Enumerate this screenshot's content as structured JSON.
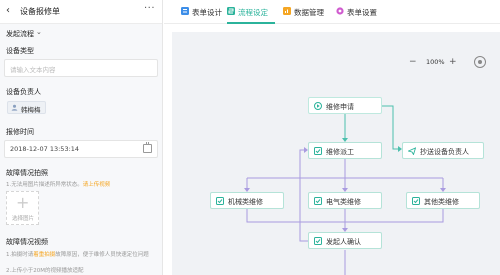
{
  "panel": {
    "back_glyph": "‹",
    "title": "设备报修单",
    "more_glyph": "···",
    "flow_label": "发起流程",
    "flow_chevron": "⌄",
    "fields": {
      "device_type_label": "设备类型",
      "device_type_placeholder": "请输入文本内容",
      "owner_label": "设备负责人",
      "owner_name": "韩梅梅",
      "time_label": "报修时间",
      "time_value": "2018-12-07 13:53:14",
      "photo_label": "故障情况拍照",
      "photo_hint_prefix": "1.无法用图片描述所异常状态。",
      "photo_hint_link": "请上传视频",
      "upload_label": "选择图片",
      "video_label": "故障情况视频",
      "video_hint_1_prefix": "1.拍摄时请",
      "video_hint_1_link": "着重拍摄",
      "video_hint_1_suffix": "故障原因，便于维修人员快速定位问题",
      "video_hint_2": "2.上传小于20M的视频播放适配"
    }
  },
  "tabs": [
    {
      "label": "表单设计",
      "icon": "form-design-icon",
      "color": "#3d8ee8",
      "active": false
    },
    {
      "label": "流程设定",
      "icon": "flow-setting-icon",
      "color": "#2bb39b",
      "active": true
    },
    {
      "label": "数据管理",
      "icon": "data-manage-icon",
      "color": "#f5a623",
      "active": false
    },
    {
      "label": "表单设置",
      "icon": "form-settings-icon",
      "color": "#d05ccf",
      "active": false
    }
  ],
  "zoom": {
    "minus": "−",
    "value": "100%",
    "plus": "+"
  },
  "flow": {
    "nodes": {
      "apply": "维修申请",
      "dispatch": "维修派工",
      "cc": "抄送设备负责人",
      "mech": "机械类维修",
      "elec": "电气类维修",
      "other": "其他类维修",
      "confirm": "发起人确认"
    }
  },
  "colors": {
    "accent": "#2bb39b",
    "edge_main": "#4cc0ad",
    "edge_branch": "#a99be0",
    "canvas_bg": "#f0f2f5"
  }
}
